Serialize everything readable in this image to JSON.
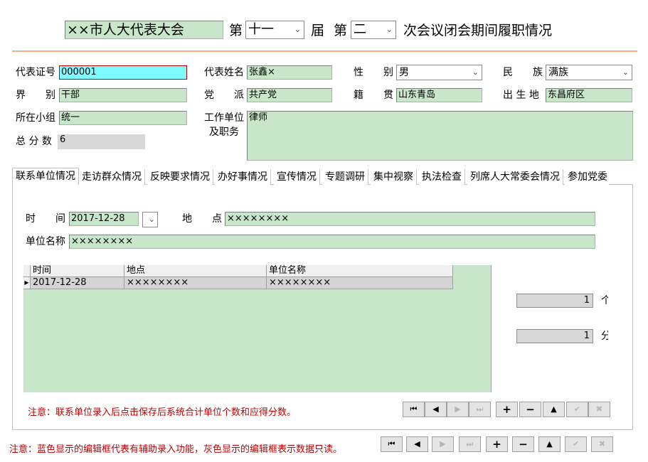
{
  "header": {
    "congress_name": "××市人大代表大会",
    "di_1": "第",
    "session": "十一",
    "jie": "届",
    "di_2": "第",
    "meeting": "二",
    "suffix": "次会议闭会期间履职情况"
  },
  "fields": {
    "rep_id_label": "代表证号",
    "rep_id": "000001",
    "rep_name_label": "代表姓名",
    "rep_name": "张鑫×",
    "gender_label": "性　　别",
    "gender": "男",
    "ethnicity_label": "民　　族",
    "ethnicity": "满族",
    "sector_label": "界　　别",
    "sector": "干部",
    "party_label": "党　　派",
    "party": "共产党",
    "origin_label": "籍　　贯",
    "origin": "山东青岛",
    "birthplace_label": "出 生 地",
    "birthplace": "东昌府区",
    "group_label": "所在小组",
    "group": "统一",
    "workunit_label_1": "工作单位",
    "workunit_label_2": "及职务",
    "workunit": "律师",
    "score_label": "总 分 数",
    "score": "6"
  },
  "tabs": [
    "联系单位情况",
    "走访群众情况",
    "反映要求情况",
    "办好事情况",
    "宣传情况",
    "专题调研",
    "集中视察",
    "执法检查",
    "列席人大常委会情况",
    "参加党委"
  ],
  "tab_panel": {
    "time_label": "时　　间",
    "time": "2017-12-28",
    "place_label": "地　　点",
    "place": "××××××××",
    "unit_label": "单位名称",
    "unit": "××××××××",
    "grid": {
      "columns": [
        "时间",
        "地点",
        "单位名称"
      ],
      "rows": [
        [
          "2017-12-28",
          "××××××××",
          "××××××××"
        ]
      ]
    },
    "count_value": "1",
    "count_unit": "个",
    "points_value": "1",
    "points_unit": "分",
    "note": "注意：联系单位录入后点击保存后系统合计单位个数和应得分数。"
  },
  "footer_note": "注意：蓝色显示的编辑框代表有辅助录入功能，灰色显示的编辑框表示数据只读。",
  "nav_icons": [
    "first-icon",
    "prev-icon",
    "next-icon",
    "last-icon",
    "plus-icon",
    "minus-icon",
    "up-icon",
    "check-icon",
    "cancel-icon"
  ],
  "colors": {
    "field_green": "#c8e6c9",
    "field_blue": "#7ffbff",
    "note_red": "#c00000",
    "separator": "#f4b183"
  }
}
